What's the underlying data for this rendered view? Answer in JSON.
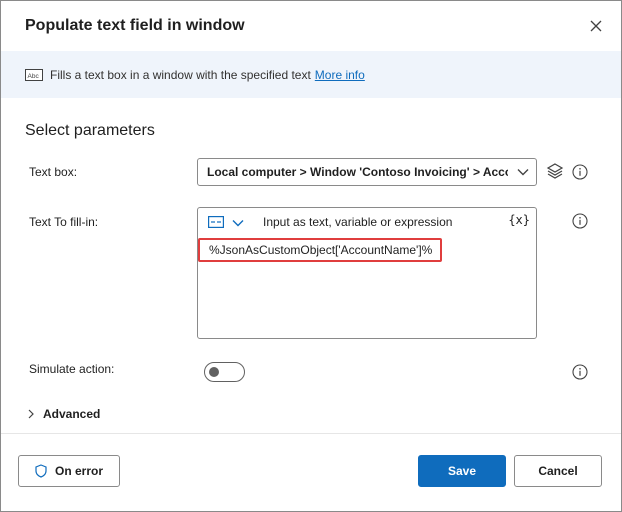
{
  "dialog": {
    "title": "Populate text field in window",
    "info": {
      "text": "Fills a text box in a window with the specified text",
      "link": "More info"
    },
    "section_title": "Select parameters",
    "params": {
      "text_box": {
        "label": "Text box:",
        "value": "Local computer > Window 'Contoso Invoicing' > Account"
      },
      "text_to_fill": {
        "label": "Text To fill-in:",
        "hint": "Input as text, variable or expression",
        "var_button": "{x}",
        "value": "%JsonAsCustomObject['AccountName']%"
      },
      "simulate_action": {
        "label": "Simulate action:",
        "enabled": false
      }
    },
    "advanced_label": "Advanced",
    "footer": {
      "on_error_label": "On error",
      "save_label": "Save",
      "cancel_label": "Cancel"
    }
  },
  "colors": {
    "accent": "#0f6cbd",
    "info_bar": "#eff4fb",
    "highlight": "#e03e3e"
  },
  "icons": {
    "close": "close-icon",
    "abc": "text-box-icon",
    "layers": "layers-icon",
    "info": "info-icon",
    "mode": "text-mode-icon",
    "chevron_down": "chevron-down-icon",
    "chevron_right": "chevron-right-icon",
    "shield": "shield-icon"
  }
}
